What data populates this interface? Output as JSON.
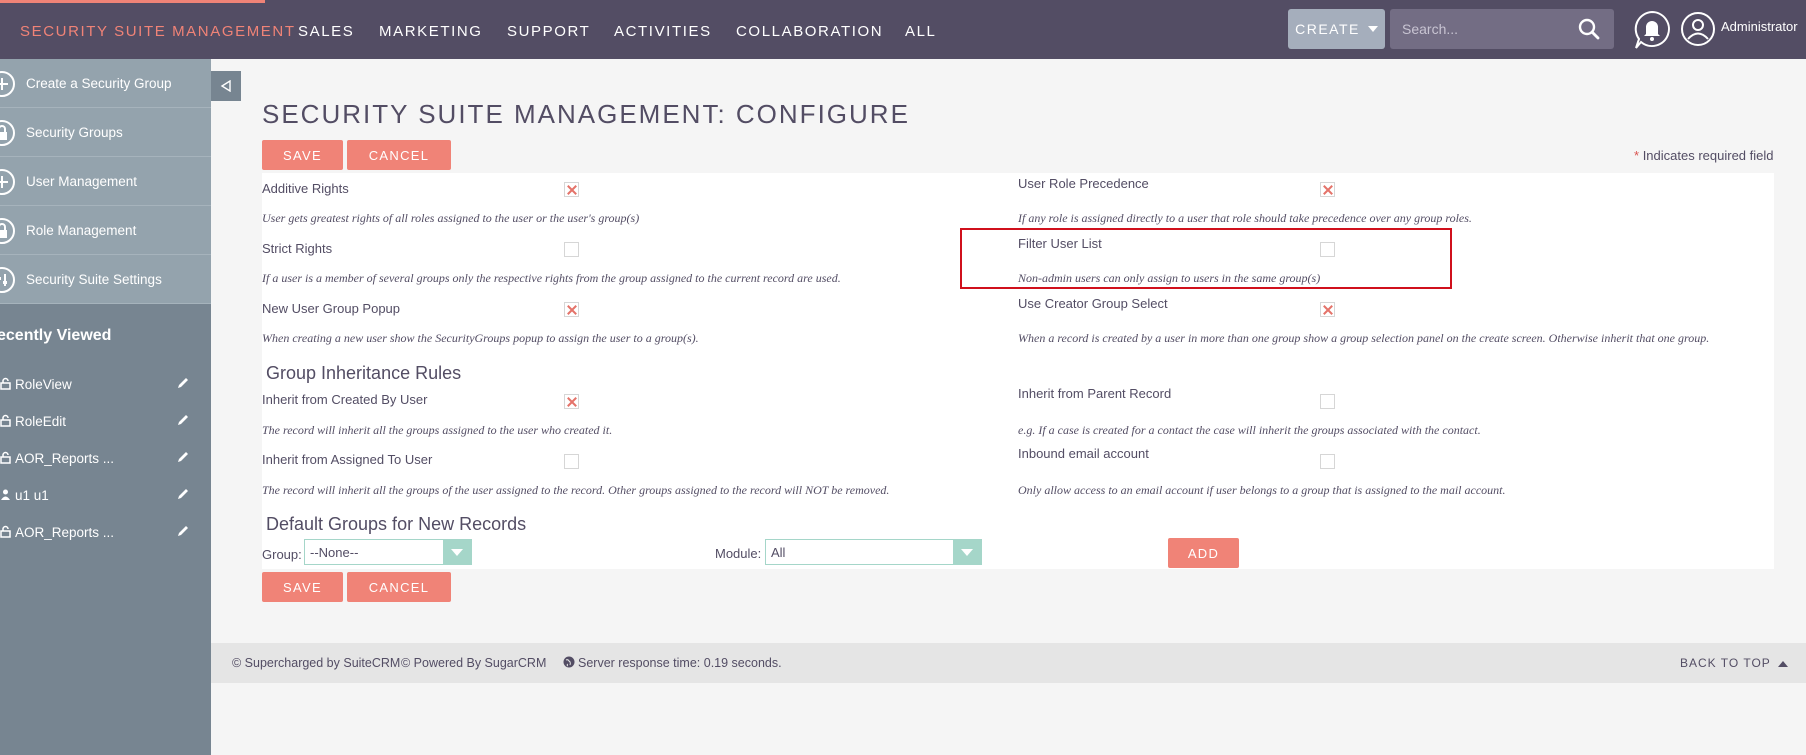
{
  "nav": {
    "brand": "SECURITY SUITE MANAGEMENT",
    "links": [
      "SALES",
      "MARKETING",
      "SUPPORT",
      "ACTIVITIES",
      "COLLABORATION",
      "ALL"
    ],
    "create_label": "CREATE",
    "search_placeholder": "Search...",
    "user": "Administrator"
  },
  "sidebar": {
    "actions": [
      {
        "label": "Create a Security Group",
        "icon": "plus-icon"
      },
      {
        "label": "Security Groups",
        "icon": "lock-icon"
      },
      {
        "label": "User Management",
        "icon": "plus-icon"
      },
      {
        "label": "Role Management",
        "icon": "lock-icon"
      },
      {
        "label": "Security Suite Settings",
        "icon": "settings-icon"
      }
    ],
    "recent_title": "ecently Viewed",
    "recent": [
      {
        "label": "RoleView",
        "icon": "lock-icon"
      },
      {
        "label": "RoleEdit",
        "icon": "lock-icon"
      },
      {
        "label": "AOR_Reports ...",
        "icon": "lock-icon"
      },
      {
        "label": "u1 u1",
        "icon": "user-icon"
      },
      {
        "label": "AOR_Reports ...",
        "icon": "lock-icon"
      }
    ]
  },
  "main": {
    "title": "SECURITY SUITE MANAGEMENT: CONFIGURE",
    "save_label": "SAVE",
    "cancel_label": "CANCEL",
    "required_note": "Indicates required field",
    "required_star": "*",
    "settings": {
      "additive_rights": {
        "label": "Additive Rights",
        "checked": true,
        "desc": "User gets greatest rights of all roles assigned to the user or the user's group(s)"
      },
      "user_role_precedence": {
        "label": "User Role Precedence",
        "checked": true,
        "desc": "If any role is assigned directly to a user that role should take precedence over any group roles."
      },
      "strict_rights": {
        "label": "Strict Rights",
        "checked": false,
        "desc": "If a user is a member of several groups only the respective rights from the group assigned to the current record are used."
      },
      "filter_user_list": {
        "label": "Filter User List",
        "checked": false,
        "desc": "Non-admin users can only assign to users in the same group(s)"
      },
      "new_user_group_popup": {
        "label": "New User Group Popup",
        "checked": true,
        "desc": "When creating a new user show the SecurityGroups popup to assign the user to a group(s)."
      },
      "use_creator_group_select": {
        "label": "Use Creator Group Select",
        "checked": true,
        "desc": "When a record is created by a user in more than one group show a group selection panel on the create screen. Otherwise inherit that one group."
      }
    },
    "inheritance_title": "Group Inheritance Rules",
    "inheritance": {
      "created_by": {
        "label": "Inherit from Created By User",
        "checked": true,
        "desc": "The record will inherit all the groups assigned to the user who created it."
      },
      "parent_record": {
        "label": "Inherit from Parent Record",
        "checked": false,
        "desc": "e.g. If a case is created for a contact the case will inherit the groups associated with the contact."
      },
      "assigned_to": {
        "label": "Inherit from Assigned To User",
        "checked": false,
        "desc": "The record will inherit all the groups of the user assigned to the record. Other groups assigned to the record will NOT be removed."
      },
      "inbound_email": {
        "label": "Inbound email account",
        "checked": false,
        "desc": "Only allow access to an email account if user belongs to a group that is assigned to the mail account."
      }
    },
    "default_groups_title": "Default Groups for New Records",
    "group_label": "Group:",
    "group_value": "--None--",
    "module_label": "Module:",
    "module_value": "All",
    "add_label": "ADD"
  },
  "footer": {
    "suitecrm": "© Supercharged by SuiteCRM",
    "sugarcrm": "© Powered By SugarCRM",
    "response": "Server response time: 0.19 seconds.",
    "back_to_top": "BACK TO TOP"
  },
  "colors": {
    "nav_bg": "#534d64",
    "accent": "#f08377",
    "sidebar_bg": "#778591",
    "highlight": "#d0101c"
  }
}
